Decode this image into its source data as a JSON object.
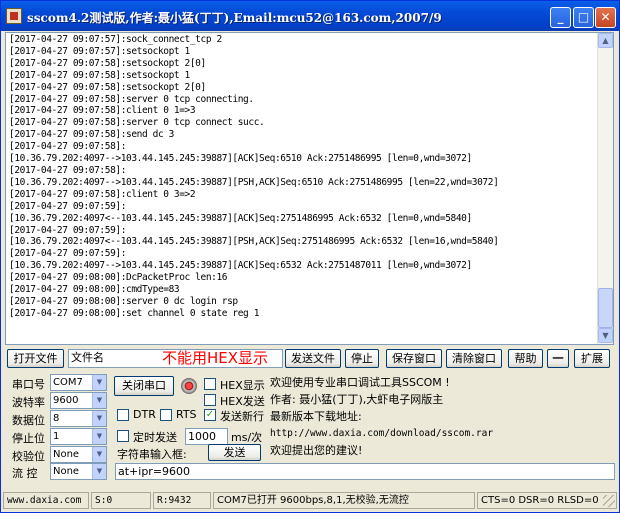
{
  "window": {
    "title": "sscom4.2测试版,作者:聂小猛(丁丁),Email:mcu52@163.com,2007/9",
    "minimize": "_",
    "maximize": "□",
    "close": "✕"
  },
  "log": {
    "lines": [
      "[2017-04-27 09:07:57]:sock_connect_tcp 2",
      "[2017-04-27 09:07:57]:setsockopt 1",
      "[2017-04-27 09:07:58]:setsockopt 2[0]",
      "[2017-04-27 09:07:58]:setsockopt 1",
      "[2017-04-27 09:07:58]:setsockopt 2[0]",
      "[2017-04-27 09:07:58]:server 0 tcp connecting.",
      "[2017-04-27 09:07:58]:client 0 1=>3",
      "[2017-04-27 09:07:58]:server 0 tcp connect succ.",
      "[2017-04-27 09:07:58]:send dc 3",
      "[2017-04-27 09:07:58]:",
      "[10.36.79.202:4097-->103.44.145.245:39887][ACK]Seq:6510 Ack:2751486995 [len=0,wnd=3072]",
      "[2017-04-27 09:07:58]:",
      "[10.36.79.202:4097-->103.44.145.245:39887][PSH,ACK]Seq:6510 Ack:2751486995 [len=22,wnd=3072]",
      "[2017-04-27 09:07:58]:client 0 3=>2",
      "[2017-04-27 09:07:59]:",
      "[10.36.79.202:4097<--103.44.145.245:39887][ACK]Seq:2751486995 Ack:6532 [len=0,wnd=5840]",
      "[2017-04-27 09:07:59]:",
      "[10.36.79.202:4097<--103.44.145.245:39887][PSH,ACK]Seq:2751486995 Ack:6532 [len=16,wnd=5840]",
      "[2017-04-27 09:07:59]:",
      "[10.36.79.202:4097-->103.44.145.245:39887][ACK]Seq:6532 Ack:2751487011 [len=0,wnd=3072]",
      "[2017-04-27 09:08:00]:DcPacketProc len:16",
      "[2017-04-27 09:08:00]:cmdType=83",
      "[2017-04-27 09:08:00]:server 0 dc login rsp",
      "[2017-04-27 09:08:00]:set channel 0 state reg 1"
    ]
  },
  "toolbar": {
    "open_file": "打开文件",
    "filename": "文件名",
    "red_note": "不能用HEX显示",
    "send_file": "发送文件",
    "stop": "停止",
    "save_window": "保存窗口",
    "clear_window": "清除窗口",
    "help": "帮助",
    "minus": "一",
    "expand": "扩展"
  },
  "serial": {
    "port_label": "串口号",
    "port_value": "COM7",
    "baud_label": "波特率",
    "baud_value": "9600",
    "databits_label": "数据位",
    "databits_value": "8",
    "stopbits_label": "停止位",
    "stopbits_value": "1",
    "parity_label": "校验位",
    "parity_value": "None",
    "flow_label": "流 控",
    "flow_value": "None"
  },
  "controls": {
    "close_port": "关闭串口",
    "hex_display": "HEX显示",
    "hex_send": "HEX发送",
    "send_newline": "发送新行",
    "dtr": "DTR",
    "rts": "RTS",
    "timed_send": "定时发送",
    "interval_value": "1000",
    "interval_unit": "ms/次",
    "string_input_label": "字符串输入框:",
    "send": "发送",
    "input_value": "at+ipr=9600",
    "hex_display_checked": false,
    "hex_send_checked": false,
    "send_newline_checked": true,
    "dtr_checked": false,
    "rts_checked": false,
    "timed_send_checked": false
  },
  "info": {
    "line1": "欢迎使用专业串口调试工具SSCOM !",
    "line2": "作者: 聂小猛(丁丁),大虾电子网版主",
    "line3": "最新版本下载地址:",
    "line4": "http://www.daxia.com/download/sscom.rar",
    "line5": "欢迎提出您的建议!"
  },
  "statusbar": {
    "site": "www.daxia.com",
    "send_count": "S:0",
    "recv_count": "R:9432",
    "port_status": "COM7已打开  9600bps,8,1,无校验,无流控",
    "line_status": "CTS=0 DSR=0 RLSD=0"
  },
  "colors": {
    "title_blue": "#0449D6",
    "red_note": "#FF0000",
    "check_green": "#21A121"
  }
}
